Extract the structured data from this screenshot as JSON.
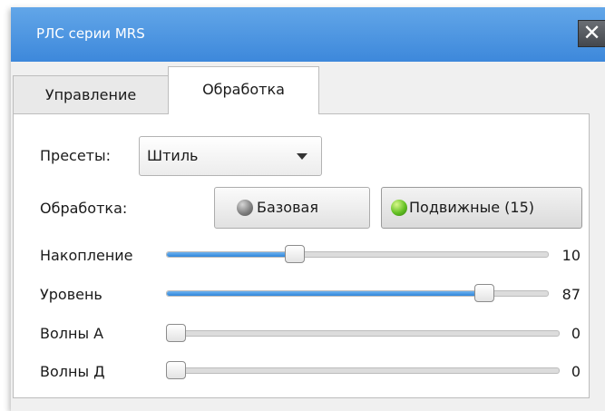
{
  "window": {
    "title": "РЛС серии MRS",
    "close_symbol": "✕"
  },
  "tabs": [
    {
      "label": "Управление",
      "active": false
    },
    {
      "label": "Обработка",
      "active": true
    }
  ],
  "presets": {
    "label": "Пресеты:",
    "selected": "Штиль"
  },
  "processing": {
    "label": "Обработка:",
    "base_button": {
      "label": "Базовая",
      "indicator": "gray",
      "icon": "gray-led-icon"
    },
    "mobile_button": {
      "label": "Подвижные (15)",
      "indicator": "green",
      "icon": "green-led-icon",
      "pressed": true
    }
  },
  "sliders": [
    {
      "label": "Накопление",
      "value": "10",
      "level": 0.33
    },
    {
      "label": "Уровень",
      "value": "87",
      "level": 0.855
    },
    {
      "label": "Волны А",
      "value": "0",
      "level": 0
    },
    {
      "label": "Волны Д",
      "value": "0",
      "level": 0
    }
  ],
  "colors": {
    "titlebar": "#3d88db",
    "slider_fill": "#2f86db",
    "led_green": "#63c023",
    "led_gray": "#7a7a7a"
  }
}
